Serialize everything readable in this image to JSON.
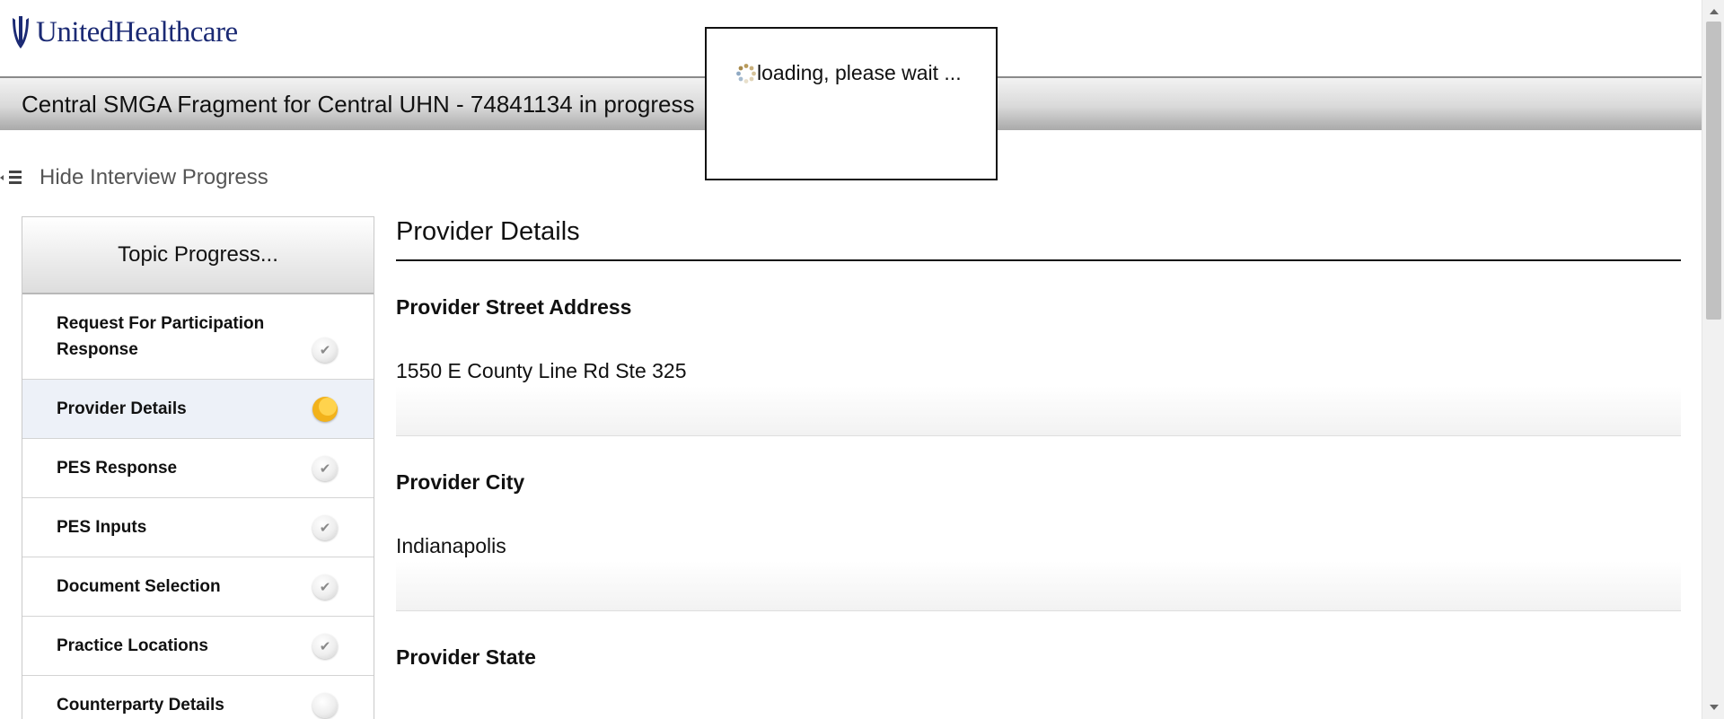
{
  "brand": {
    "name": "UnitedHealthcare",
    "color": "#1b2a74"
  },
  "header": {
    "title": "Central SMGA Fragment for Central UHN - 74841134 in progress"
  },
  "progress_toggle": {
    "label": "Hide Interview Progress",
    "icon": "collapse-list-icon"
  },
  "sidebar": {
    "title": "Topic Progress...",
    "topics": [
      {
        "label": "Request For Participation Response",
        "status": "complete"
      },
      {
        "label": "Provider Details",
        "status": "in-progress"
      },
      {
        "label": "PES Response",
        "status": "complete"
      },
      {
        "label": "PES Inputs",
        "status": "complete"
      },
      {
        "label": "Document Selection",
        "status": "complete"
      },
      {
        "label": "Practice Locations",
        "status": "complete"
      },
      {
        "label": "Counterparty Details",
        "status": "not-started"
      }
    ],
    "status_icons": {
      "complete": "✔",
      "in-progress": "",
      "not-started": ""
    }
  },
  "main": {
    "section_title": "Provider Details",
    "fields": [
      {
        "label": "Provider Street Address",
        "value": "1550 E County Line Rd Ste 325"
      },
      {
        "label": "Provider City",
        "value": "Indianapolis"
      },
      {
        "label": "Provider State",
        "value": ""
      }
    ]
  },
  "loading": {
    "text": "loading, please wait ...",
    "icon": "spinner-icon"
  },
  "colors": {
    "active_topic_bg": "#edf1f8",
    "progress_orange": "#f2b21b"
  }
}
